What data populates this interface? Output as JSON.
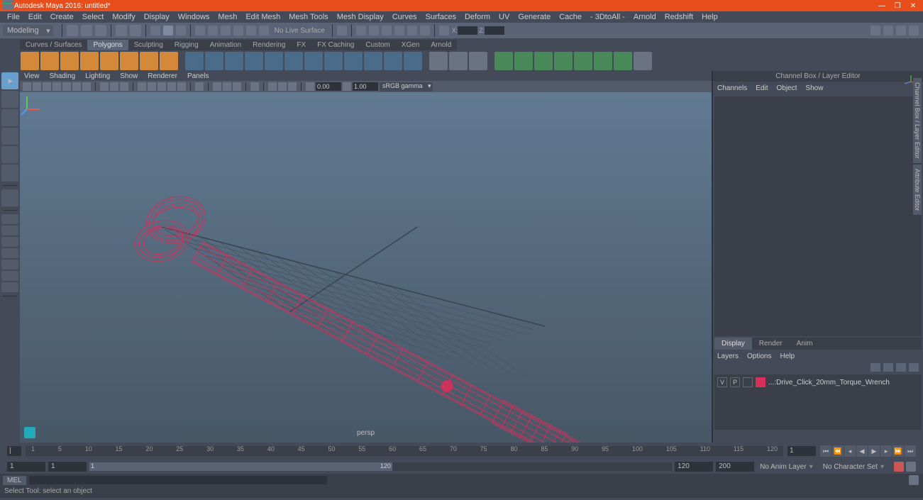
{
  "title": "Autodesk Maya 2016: untitled*",
  "menu": [
    "File",
    "Edit",
    "Create",
    "Select",
    "Modify",
    "Display",
    "Windows",
    "Mesh",
    "Edit Mesh",
    "Mesh Tools",
    "Mesh Display",
    "Curves",
    "Surfaces",
    "Deform",
    "UV",
    "Generate",
    "Cache",
    "- 3DtoAll -",
    "Arnold",
    "Redshift",
    "Help"
  ],
  "workspace": "Modeling",
  "no_live_surface": "No Live Surface",
  "status_coords": {
    "x_label": "X:",
    "x": "",
    "z_label": "Z:",
    "z": ""
  },
  "shelf_tabs": [
    "Curves / Surfaces",
    "Polygons",
    "Sculpting",
    "Rigging",
    "Animation",
    "Rendering",
    "FX",
    "FX Caching",
    "Custom",
    "XGen",
    "Arnold"
  ],
  "shelf_active": "Polygons",
  "vp_menu": [
    "View",
    "Shading",
    "Lighting",
    "Show",
    "Renderer",
    "Panels"
  ],
  "vp_input1": "0.00",
  "vp_input2": "1.00",
  "vp_colorspace": "sRGB gamma",
  "persp": "persp",
  "rp_title": "Channel Box / Layer Editor",
  "rp_tabs": [
    "Channels",
    "Edit",
    "Object",
    "Show"
  ],
  "layer_tabs": [
    "Display",
    "Render",
    "Anim"
  ],
  "layer_tab_active": "Display",
  "layer_opts": [
    "Layers",
    "Options",
    "Help"
  ],
  "layer_row": {
    "v": "V",
    "p": "P",
    "name": "...:Drive_Click_20mm_Torque_Wrench"
  },
  "right_side_tabs": [
    "Channel Box / Layer Editor",
    "Attribute Editor"
  ],
  "timeline_ticks": [
    "1",
    "5",
    "10",
    "15",
    "20",
    "25",
    "30",
    "35",
    "40",
    "45",
    "50",
    "55",
    "60",
    "65",
    "70",
    "75",
    "80",
    "85",
    "90",
    "95",
    "100",
    "105",
    "110",
    "115",
    "120"
  ],
  "timeline_end": "1",
  "range": {
    "start_outer": "1",
    "start_inner": "1",
    "end_inner": "120",
    "end_outer": "200"
  },
  "anim_layer": "No Anim Layer",
  "char_set": "No Character Set",
  "cmd_label": "MEL",
  "help_text": "Select Tool: select an object"
}
